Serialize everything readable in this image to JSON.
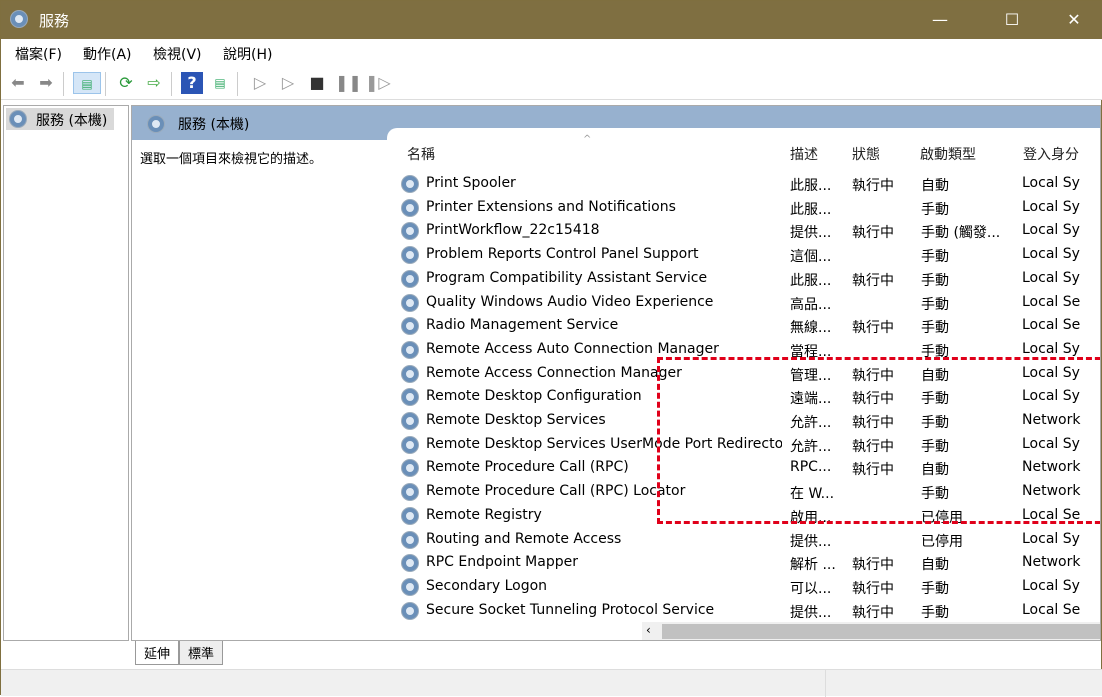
{
  "window": {
    "title": "服務",
    "minimize": "—",
    "maximize": "☐",
    "close": "✕"
  },
  "menu": [
    "檔案(F)",
    "動作(A)",
    "檢視(V)",
    "說明(H)"
  ],
  "toolbar": {
    "icons": [
      "back-icon",
      "forward-icon",
      "show-hide-console-tree-icon",
      "refresh-icon",
      "export-list-icon",
      "help-icon",
      "show-action-pane-icon",
      "start-service-icon",
      "start-service-alt-icon",
      "stop-service-icon",
      "pause-service-icon",
      "resume-service-icon"
    ]
  },
  "tree": {
    "root": "服務 (本機)"
  },
  "pane": {
    "header": "服務 (本機)",
    "description": "選取一個項目來檢視它的描述。"
  },
  "columns": {
    "name": "名稱",
    "desc": "描述",
    "status": "狀態",
    "startup": "啟動類型",
    "logon": "登入身分"
  },
  "services": [
    {
      "name": "Print Spooler",
      "desc": "此服...",
      "status": "執行中",
      "startup": "自動",
      "logon": "Local Sy"
    },
    {
      "name": "Printer Extensions and Notifications",
      "desc": "此服...",
      "status": "",
      "startup": "手動",
      "logon": "Local Sy"
    },
    {
      "name": "PrintWorkflow_22c15418",
      "desc": "提供...",
      "status": "執行中",
      "startup": "手動 (觸發...",
      "logon": "Local Sy"
    },
    {
      "name": "Problem Reports Control Panel Support",
      "desc": "這個...",
      "status": "",
      "startup": "手動",
      "logon": "Local Sy"
    },
    {
      "name": "Program Compatibility Assistant Service",
      "desc": "此服...",
      "status": "執行中",
      "startup": "手動",
      "logon": "Local Sy"
    },
    {
      "name": "Quality Windows Audio Video Experience",
      "desc": "高品...",
      "status": "",
      "startup": "手動",
      "logon": "Local Se"
    },
    {
      "name": "Radio Management Service",
      "desc": "無線...",
      "status": "執行中",
      "startup": "手動",
      "logon": "Local Se"
    },
    {
      "name": "Remote Access Auto Connection Manager",
      "desc": "當程...",
      "status": "",
      "startup": "手動",
      "logon": "Local Sy"
    },
    {
      "name": "Remote Access Connection Manager",
      "desc": "管理...",
      "status": "執行中",
      "startup": "自動",
      "logon": "Local Sy"
    },
    {
      "name": "Remote Desktop Configuration",
      "desc": "遠端...",
      "status": "執行中",
      "startup": "手動",
      "logon": "Local Sy"
    },
    {
      "name": "Remote Desktop Services",
      "desc": "允許...",
      "status": "執行中",
      "startup": "手動",
      "logon": "Network"
    },
    {
      "name": "Remote Desktop Services UserMode Port Redirector",
      "desc": "允許...",
      "status": "執行中",
      "startup": "手動",
      "logon": "Local Sy"
    },
    {
      "name": "Remote Procedure Call (RPC)",
      "desc": "RPC...",
      "status": "執行中",
      "startup": "自動",
      "logon": "Network"
    },
    {
      "name": "Remote Procedure Call (RPC) Locator",
      "desc": "在 W...",
      "status": "",
      "startup": "手動",
      "logon": "Network"
    },
    {
      "name": "Remote Registry",
      "desc": "啟用...",
      "status": "",
      "startup": "已停用",
      "logon": "Local Se"
    },
    {
      "name": "Routing and Remote Access",
      "desc": "提供...",
      "status": "",
      "startup": "已停用",
      "logon": "Local Sy"
    },
    {
      "name": "RPC Endpoint Mapper",
      "desc": "解析 ...",
      "status": "執行中",
      "startup": "自動",
      "logon": "Network"
    },
    {
      "name": "Secondary Logon",
      "desc": "可以...",
      "status": "執行中",
      "startup": "手動",
      "logon": "Local Sy"
    },
    {
      "name": "Secure Socket Tunneling Protocol Service",
      "desc": "提供...",
      "status": "執行中",
      "startup": "手動",
      "logon": "Local Se"
    }
  ],
  "tabs": [
    "延伸",
    "標準"
  ],
  "highlight_color": "#e0001a"
}
